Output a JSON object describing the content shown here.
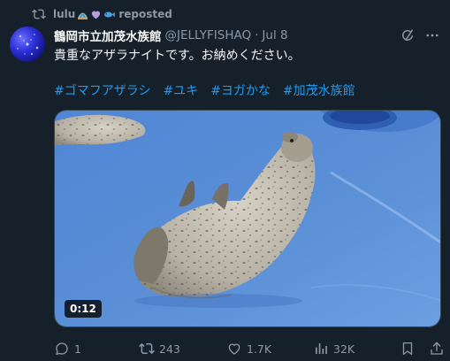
{
  "repost": {
    "user": "lulu",
    "suffix": "reposted",
    "emojis": [
      "rock-shell-emoji",
      "purple-heart-emoji",
      "fish-emoji"
    ]
  },
  "author": {
    "display_name": "鶴岡市立加茂水族館",
    "handle": "@JELLYFISHAQ",
    "separator": "·",
    "date": "Jul 8"
  },
  "tweet": {
    "text": "貴重なアザラナイトです。お納めください。",
    "hashtags": [
      "#ゴマフアザラシ",
      "#ユキ",
      "#ヨガかな",
      "#加茂水族館"
    ]
  },
  "media": {
    "type": "video",
    "duration": "0:12",
    "subject": "spotted seal curled up on blue floor"
  },
  "actions": {
    "replies": "1",
    "reposts": "243",
    "likes": "1.7K",
    "views": "32K"
  },
  "colors": {
    "background": "#15202b",
    "text": "#f7f9f9",
    "muted": "#8b98a5",
    "link": "#1d9bf0",
    "media_blue": "#5b8fd6"
  }
}
